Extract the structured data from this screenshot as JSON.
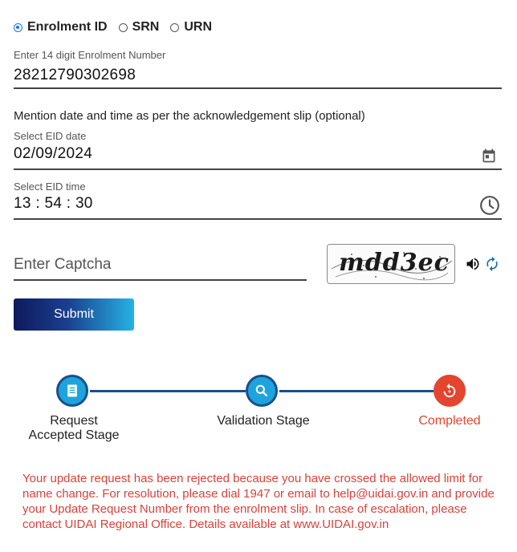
{
  "id_type": {
    "options": [
      "Enrolment ID",
      "SRN",
      "URN"
    ],
    "selected": "Enrolment ID"
  },
  "enrolment": {
    "label": "Enter 14 digit Enrolment Number",
    "value": "28212790302698"
  },
  "note": "Mention date and time as per the acknowledgement slip (optional)",
  "eid_date": {
    "label": "Select EID date",
    "value": "02/09/2024",
    "icon": "calendar-icon"
  },
  "eid_time": {
    "label": "Select EID time",
    "value": "13 : 54 : 30",
    "icon": "clock-icon"
  },
  "captcha": {
    "placeholder": "Enter Captcha",
    "image_text": "mdd3ec",
    "audio_icon": "speaker-icon",
    "refresh_icon": "refresh-icon"
  },
  "submit_label": "Submit",
  "stages": [
    {
      "label_line1": "Request",
      "label_line2": "Accepted Stage",
      "icon": "document-icon",
      "status": "done"
    },
    {
      "label_line1": "Validation Stage",
      "label_line2": "",
      "icon": "search-icon",
      "status": "done"
    },
    {
      "label_line1": "Completed",
      "label_line2": "",
      "icon": "rejected-icon",
      "status": "rejected"
    }
  ],
  "message": "Your update request has been rejected because you have crossed the allowed limit for name change. For resolution, please dial 1947 or email to help@uidai.gov.in and provide your Update Request Number from the enrolment slip. In case of escalation, please contact UIDAI Regional Office. Details available at www.UIDAI.gov.in",
  "colors": {
    "accent": "#1a73e8",
    "stage_blue": "#1fa3dc",
    "stage_line": "#1a4f8e",
    "rejected": "#e3452f",
    "message": "#d9423a"
  }
}
